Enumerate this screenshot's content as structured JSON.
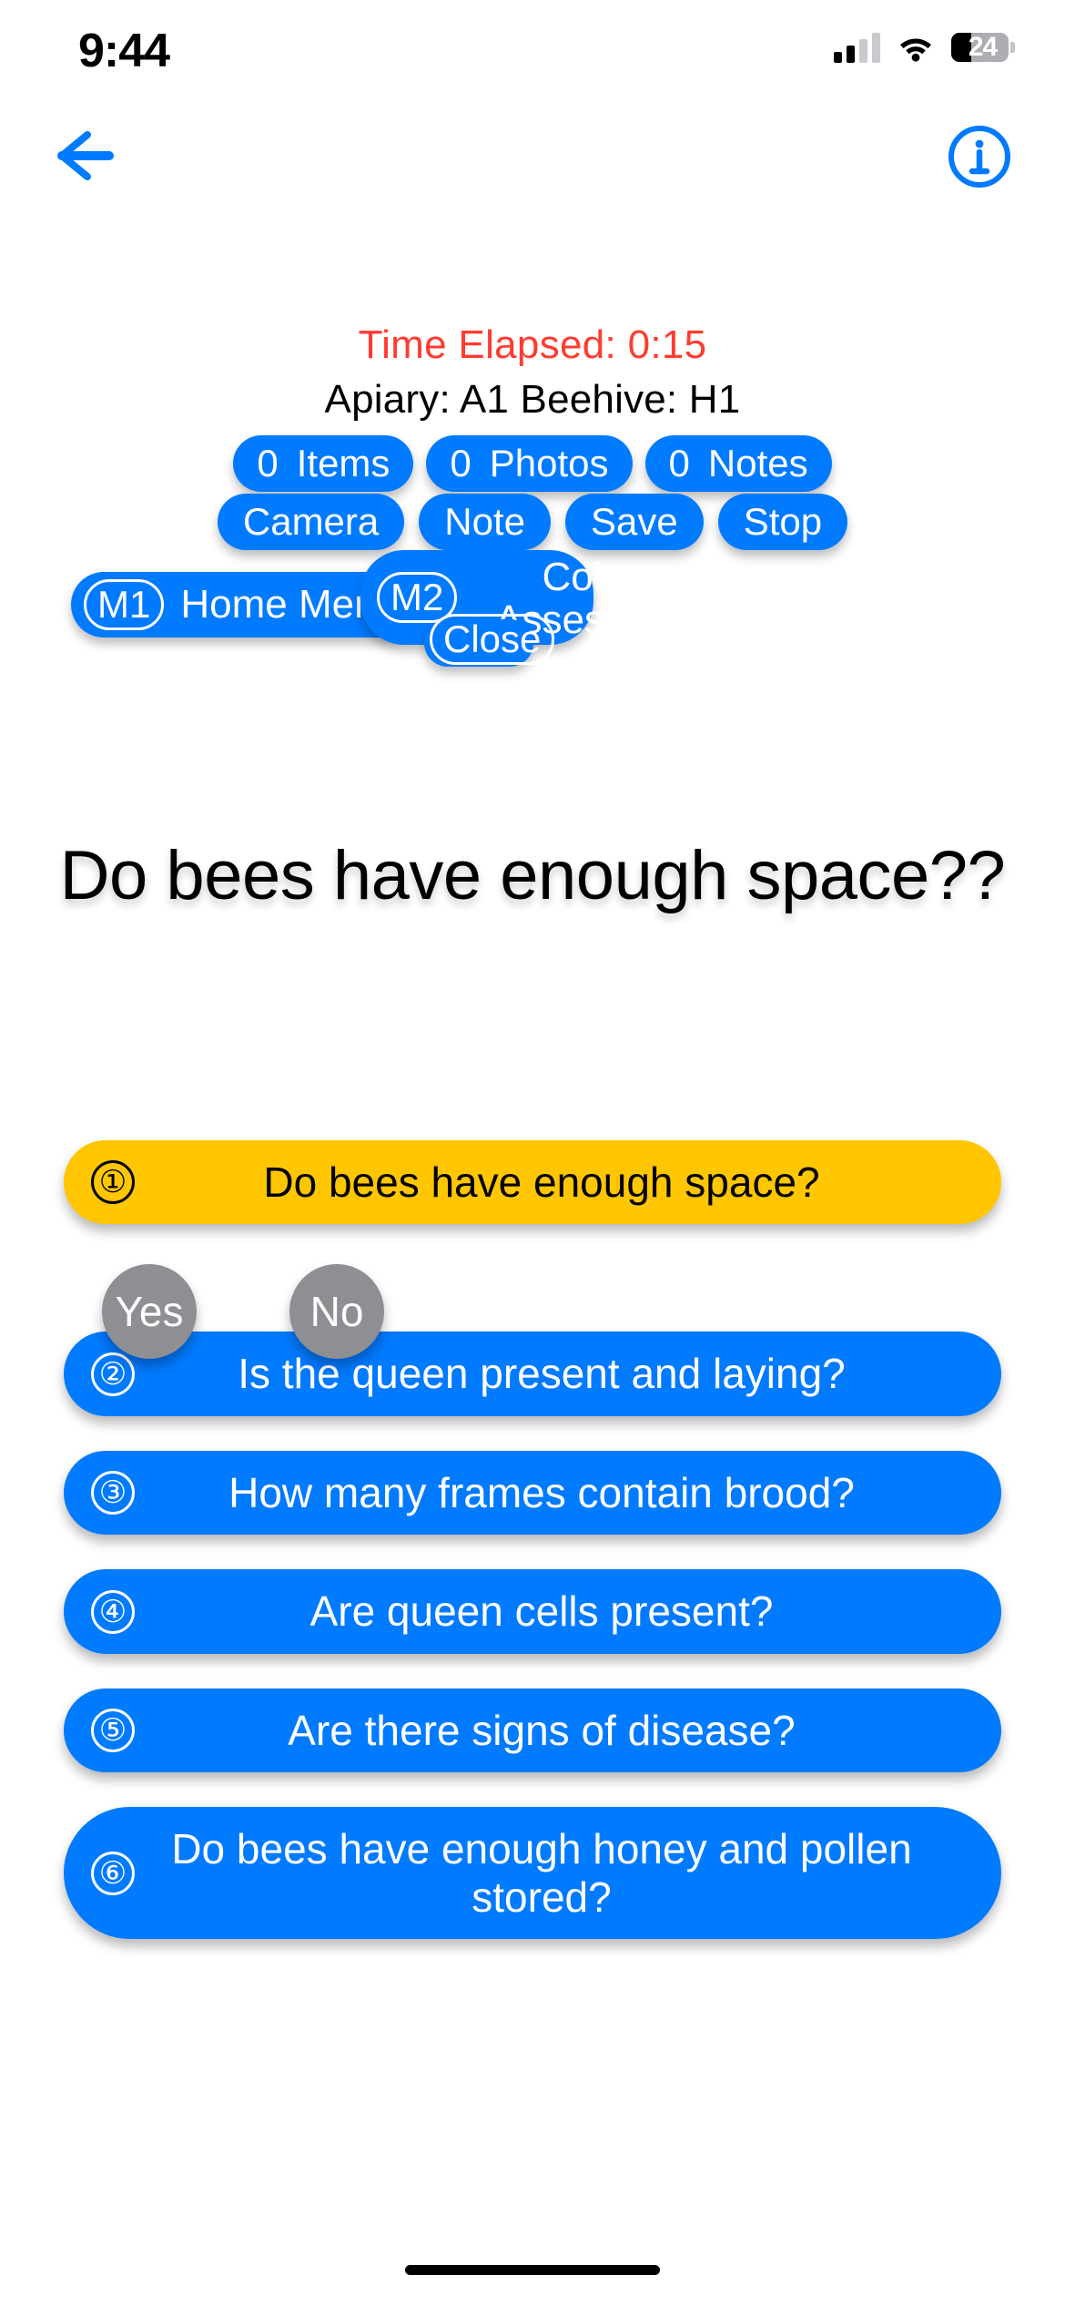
{
  "status_bar": {
    "time": "9:44",
    "battery_level": "24",
    "signal_icon": "cellular-signal-icon",
    "wifi_icon": "wifi-icon",
    "battery_icon": "battery-icon"
  },
  "nav": {
    "back_icon": "back-arrow-icon",
    "info_icon": "info-circle-icon"
  },
  "header": {
    "elapsed_label": "Time Elapsed:",
    "elapsed_value": "0:15",
    "elapsed_text": "Time Elapsed:  0:15",
    "location_text": "Apiary: A1 Beehive: H1",
    "elapsed_color": "#FF3B30"
  },
  "counters": [
    {
      "count": "0",
      "label": "Items"
    },
    {
      "count": "0",
      "label": "Photos"
    },
    {
      "count": "0",
      "label": "Notes"
    }
  ],
  "actions": [
    {
      "label": "Camera"
    },
    {
      "label": "Note"
    },
    {
      "label": "Save"
    },
    {
      "label": "Stop"
    }
  ],
  "menus": {
    "m1": {
      "badge": "M1",
      "label": "Home Menu"
    },
    "m2": {
      "badge": "M2",
      "label": "Colony Assessment"
    },
    "close": {
      "label": "Close"
    }
  },
  "big_question": "Do bees have enough space??",
  "answers": {
    "yes": "Yes",
    "no": "No"
  },
  "colors": {
    "accent_blue": "#007AFF",
    "active_yellow": "#FFC601",
    "answer_gray": "#8E8E93",
    "alert_red": "#FF3B30"
  },
  "questions": [
    {
      "num": "①",
      "text": "Do bees have enough space?",
      "state": "active"
    },
    {
      "num": "②",
      "text": "Is the queen present and laying?",
      "state": "default"
    },
    {
      "num": "③",
      "text": "How many frames contain brood?",
      "state": "default"
    },
    {
      "num": "④",
      "text": "Are queen cells present?",
      "state": "default"
    },
    {
      "num": "⑤",
      "text": "Are there signs of disease?",
      "state": "default"
    },
    {
      "num": "⑥",
      "text": "Do bees have enough honey and pollen stored?",
      "state": "default"
    }
  ]
}
